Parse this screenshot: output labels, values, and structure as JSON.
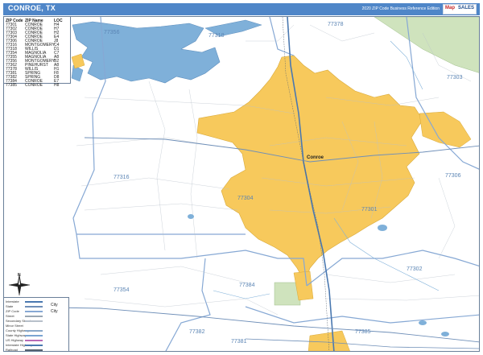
{
  "header": {
    "title": "CONROE, TX",
    "edition": "2020 ZIP Code Business Reference Edition",
    "logo_map": "Map",
    "logo_sales": "SALES"
  },
  "index": {
    "headers": [
      "ZIP Code",
      "ZIP Name",
      "LOC"
    ],
    "rows": [
      [
        "77301",
        "CONROE",
        "H4"
      ],
      [
        "77302",
        "CONROE",
        "H7"
      ],
      [
        "77303",
        "CONROE",
        "H2"
      ],
      [
        "77304",
        "CONROE",
        "E4"
      ],
      [
        "77306",
        "CONROE",
        "J8"
      ],
      [
        "77316",
        "MONTGOMERY",
        "C4"
      ],
      [
        "77318",
        "WILLIS",
        "D1"
      ],
      [
        "77354",
        "MAGNOLIA",
        "C7"
      ],
      [
        "77355",
        "MAGNOLIA",
        "A8"
      ],
      [
        "77356",
        "MONTGOMERY",
        "B2"
      ],
      [
        "77362",
        "PINEHURST",
        "A8"
      ],
      [
        "77378",
        "WILLIS",
        "H1"
      ],
      [
        "77381",
        "SPRING",
        "F8"
      ],
      [
        "77382",
        "SPRING",
        "D8"
      ],
      [
        "77384",
        "CONROE",
        "E7"
      ],
      [
        "77385",
        "CONROE",
        "H8"
      ]
    ]
  },
  "legend": {
    "items": [
      "Interstate",
      "State",
      "ZIP Code",
      "Street",
      "Secondary Street",
      "Minor Street",
      "County Highway",
      "State Highway",
      "US Highway",
      "Interstate Highway",
      "Railroad"
    ],
    "city_label": "City"
  },
  "compass_label": "N",
  "map_labels": {
    "z77356": "77356",
    "z77318": "77318",
    "z77378": "77378",
    "z77303": "77303",
    "z77316": "77316",
    "z77304": "77304",
    "z77301": "77301",
    "z77306": "77306",
    "z77302": "77302",
    "z77354": "77354",
    "z77384": "77384",
    "z77382": "77382",
    "z77385": "77385",
    "z77381": "77381",
    "city": "Conroe"
  },
  "colors": {
    "city_fill": "#f7c95c",
    "water": "#7fb0d9",
    "park": "#cfe3bd",
    "zip_boundary": "#86a8d4",
    "roads": "#9aa7b4",
    "highway": "#4a78b0",
    "title_bar": "#4f86c8"
  }
}
